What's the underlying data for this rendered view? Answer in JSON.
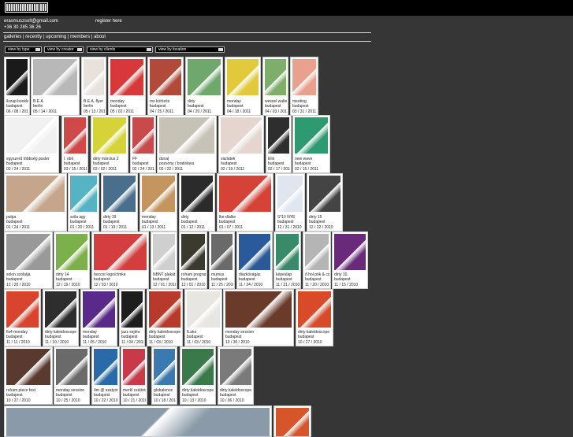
{
  "header": {
    "email": "erasmuszsolt@gmail.com",
    "phone": "+36 30 285 36 26",
    "register": "register here"
  },
  "nav": {
    "items": [
      "galleries",
      "recently",
      "upcoming",
      "members",
      "about"
    ],
    "separator": " | "
  },
  "filters": [
    "view by type",
    "view by creator",
    "view by clients",
    "view by location"
  ],
  "colors": {
    "background": "#363636",
    "topbar": "#000000",
    "card": "#ffffff"
  },
  "items": [
    {
      "title": "ilzzap booklet",
      "city": "budapest",
      "date": "06 / 08 / 2011",
      "color": "#1a1a1a"
    },
    {
      "title": "B.E.A",
      "city": "berlin",
      "date": "05 / 14 / 2011",
      "color": "#b8b8b8"
    },
    {
      "title": "B.E.A. flyer",
      "city": "berlin",
      "date": "05 / 13 / 2011",
      "color": "#e7e2dc"
    },
    {
      "title": "monday",
      "city": "budapest",
      "date": "05 / 02 / 2011",
      "color": "#d9383a"
    },
    {
      "title": "ms kötözés",
      "city": "budapest",
      "date": "04 / 25 / 2011",
      "color": "#b24a3a"
    },
    {
      "title": "dirty",
      "city": "budapest",
      "date": "04 / 20 / 2011",
      "color": "#6fa86c"
    },
    {
      "title": "monday",
      "city": "budapest",
      "date": "04 / 18 / 2011",
      "color": "#e2c93c"
    },
    {
      "title": "wessel walter",
      "city": "budapest",
      "date": "04 / 03 / 2011",
      "color": "#7fae6a"
    },
    {
      "title": "meeting",
      "city": "budapest",
      "date": "03 / 31 / 2011",
      "color": "#eaa08e"
    },
    {
      "title": "egyszerű többség poster",
      "city": "budapest",
      "date": "03 / 24 / 2011",
      "color": "#f1f1f1"
    },
    {
      "title": "l. obit",
      "city": "budapest",
      "date": "03 / 15 / 2011",
      "color": "#d04848"
    },
    {
      "title": "dirty március 2",
      "city": "budapest",
      "date": "03 / 02 / 2011",
      "color": "#d6d338"
    },
    {
      "title": "FF",
      "city": "budapest",
      "date": "02 / 24 / 2011",
      "color": "#c94a4a"
    },
    {
      "title": "duna|",
      "city": "pozsony / bratislava",
      "date": "02 / 22 / 2011",
      "color": "#c7c2b6"
    },
    {
      "title": "vázlatok",
      "city": "budapest",
      "date": "02 / 19 / 2011",
      "color": "#e4d6cf"
    },
    {
      "title": "Élni",
      "city": "budapest",
      "date": "02 / 17 / 2011",
      "color": "#2e2e2e"
    },
    {
      "title": "new wave",
      "city": "budapest",
      "date": "02 / 15 / 2011",
      "color": "#2e9a72"
    },
    {
      "title": "pulpa",
      "city": "budapest",
      "date": "01 / 24 / 2011",
      "color": "#c5a58b"
    },
    {
      "title": "szila agy",
      "city": "budapest",
      "date": "01 / 20 / 2011",
      "color": "#55b3c4"
    },
    {
      "title": "dirty 19",
      "city": "budapest",
      "date": "01 / 19 / 2011",
      "color": "#4a6f8c"
    },
    {
      "title": "monday",
      "city": "budapest",
      "date": "01 / 13 / 2011",
      "color": "#c4955f"
    },
    {
      "title": "dirty",
      "city": "budapest",
      "date": "01 / 12 / 2011",
      "color": "#2b2b2b"
    },
    {
      "title": "lke-dlalke",
      "city": "budapest",
      "date": "01 / 07 / 2011",
      "color": "#d44238"
    },
    {
      "title": "S*10 NYE",
      "city": "budapest",
      "date": "12 / 31 / 2010",
      "color": "#dfe6f0"
    },
    {
      "title": "dirty 15",
      "city": "budapest",
      "date": "12 / 22 / 2010",
      "color": "#444444"
    },
    {
      "title": "solon szobája",
      "city": "budapest",
      "date": "12 / 20 / 2010",
      "color": "#999999"
    },
    {
      "title": "dirty 14",
      "city": "budapest",
      "date": "12 / 19 / 2010",
      "color": "#7bb04a"
    },
    {
      "title": "boccor logo/címke",
      "city": "budapest",
      "date": "12 / 03 / 2010",
      "color": "#d43e3e"
    },
    {
      "title": "NBNT plakát",
      "city": "budapest",
      "date": "12 / 01 / 2010",
      "color": "#cfcfcf"
    },
    {
      "title": "roham program",
      "city": "budapest",
      "date": "12 / 01 / 2010",
      "color": "#3a3a2e"
    },
    {
      "title": "mumus",
      "city": "budapest",
      "date": "11 / 25 / 2010",
      "color": "#6a6a6a"
    },
    {
      "title": "diszkóvágás",
      "city": "budapest",
      "date": "11 / 24 / 2010",
      "color": "#2a5a9a"
    },
    {
      "title": "képeslap",
      "city": "budapest",
      "date": "11 / 21 / 2010",
      "color": "#3a8a6a"
    },
    {
      "title": "ő hol pók & cd",
      "city": "budapest",
      "date": "11 / 20 / 2010",
      "color": "#b5b5b5"
    },
    {
      "title": "dirty 10.",
      "city": "budapest",
      "date": "11 / 15 / 2010",
      "color": "#6a2a7a"
    },
    {
      "title": "fix4 monday",
      "city": "budapest",
      "date": "11 / 11 / 2010",
      "color": "#d8442e"
    },
    {
      "title": "dirty kaleidoscope",
      "city": "budapest",
      "date": "11 / 10 / 2010",
      "color": "#2e2e2e"
    },
    {
      "title": "monday",
      "city": "budapest",
      "date": "11 / 05 / 2010",
      "color": "#5a2a8a"
    },
    {
      "title": "jazz sejtés",
      "city": "budapest",
      "date": "11 / 04 / 2010",
      "color": "#1e1e1e"
    },
    {
      "title": "dirty kaleidoscope",
      "city": "budapest",
      "date": "11 / 03 / 2010",
      "color": "#b83a2a"
    },
    {
      "title": "fLako",
      "city": "budapest",
      "date": "11 / 03 / 2010",
      "color": "#e8e6e0"
    },
    {
      "title": "monday session",
      "city": "budapest",
      "date": "10 / 30 / 2010",
      "color": "#6a3a2a"
    },
    {
      "title": "dirty kaleidoscope",
      "city": "budapest",
      "date": "10 / 27 / 2010",
      "color": "#d84a2a"
    },
    {
      "title": "roham piece fest",
      "city": "budapest",
      "date": "10 / 27 / 2010",
      "color": "#5a3a2e"
    },
    {
      "title": "monday session",
      "city": "budapest",
      "date": "10 / 25 / 2010",
      "color": "#6a6a6a"
    },
    {
      "title": "4m @ szatyor",
      "city": "budapest",
      "date": "10 / 22 / 2010",
      "color": "#2a6aa8"
    },
    {
      "title": "merkl csütörtök",
      "city": "budapest",
      "date": "10 / 21 / 2010",
      "color": "#c83a4a"
    },
    {
      "title": "globalence",
      "city": "budapest",
      "date": "10 / 18 / 2010",
      "color": "#3a7ab0"
    },
    {
      "title": "dirty kaleidoscope",
      "city": "budapest",
      "date": "10 / 13 / 2010",
      "color": "#3a7a4a"
    },
    {
      "title": "dirty kaleidoscope",
      "city": "budapest",
      "date": "10 / 06 / 2010",
      "color": "#7a7a7a"
    },
    {
      "title": "",
      "city": "",
      "date": "",
      "color": "#8a9aa8"
    },
    {
      "title": "",
      "city": "",
      "date": "",
      "color": "#d6552a"
    }
  ]
}
